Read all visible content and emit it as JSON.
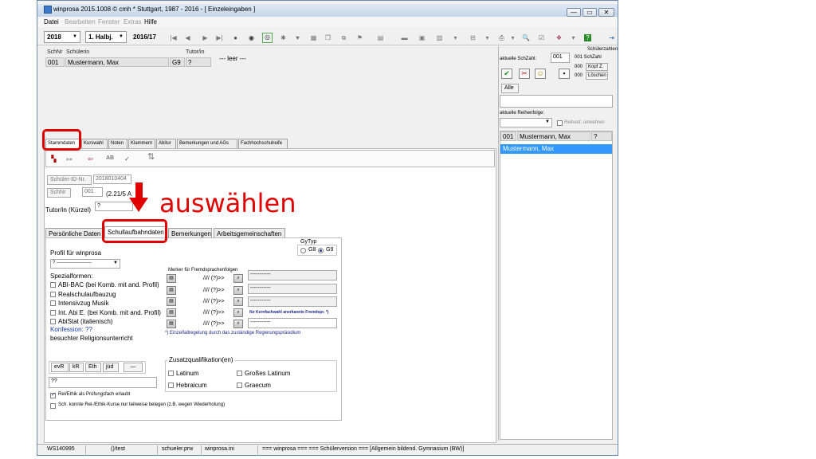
{
  "window": {
    "title": "winprosa 2015.1008 © cmh * Stuttgart, 1987 - 2016 - [ Einzeleingaben ]",
    "buttons": {
      "minimize": "—",
      "restore": "▭",
      "close": "✕"
    }
  },
  "menu": [
    "Datei",
    "Bearbeiten",
    "Fenster",
    "Extras",
    "Hilfe"
  ],
  "toolbar": {
    "year": "2018",
    "half": "1. Halbj.",
    "schoolyear": "2016/17"
  },
  "student_header": {
    "col_schnr": "SchNr",
    "col_schueler": "Schülerin",
    "col_tutor": "Tutor/in",
    "schnr": "001",
    "name": "Mustermann, Max",
    "klasse": "G9",
    "tutor": "?",
    "empty_label": "--- leer ---"
  },
  "tabs": [
    "Stammdaten",
    "Kurswahl",
    "Noten",
    "Klammern",
    "Abitur",
    "Bemerkungen und AGs",
    "Fachhochschulreife"
  ],
  "stammdaten": {
    "schueler_id_label": "Schüler-ID-Nr.",
    "schueler_id": "2018010404",
    "schnr_label": "SchNr",
    "schnr": "001",
    "schnr_extra": "(2.21/5 A",
    "tutor_label": "Tutor/in (Kürzel)",
    "tutor_value": "?"
  },
  "annotation": {
    "text": "auswählen"
  },
  "subtabs": [
    "Persönliche Daten",
    "Schullaufbahndaten",
    "Bemerkungen",
    "Arbeitsgemeinschaften"
  ],
  "schullaufbahn": {
    "gytyp_label": "GyTyp",
    "g8": "G8",
    "g9": "G9",
    "profil_label": "Profil für winprosa",
    "profil_value": "? ----------------------",
    "spezialformen_label": "Spezialformen:",
    "spezialformen": [
      "ABI-BAC (bei Komb. mit and. Profil)",
      "Realschulaufbauzug",
      "Intensivzug Musik",
      "Int. Abi E. (bei Komb. mit and. Profil)",
      "AbiStat (italienisch)"
    ],
    "konfession": "Konfession: ??",
    "religion_label": "besuchter Religionsunterricht",
    "religion_buttons": [
      "evR",
      "kR",
      "Eth",
      "jüd",
      "—"
    ],
    "religion_value": "??",
    "check_pruefung": "Rel/Ethik als Prüfungsfach erlaubt",
    "check_konnte": "Sch. konnte Rel-/Ethik-Kurse nur teilweise belegen (z.B. wegen Wiederholung)",
    "merker_label": "Merker für Fremdsprachenfolgen",
    "merker_rows": [
      {
        "code": "//// (?)>>",
        "value": "-----------"
      },
      {
        "code": "//// (?)>>",
        "value": "-----------"
      },
      {
        "code": "//// (?)>>",
        "value": "-----------"
      },
      {
        "code": "//// (?)>>",
        "value": "für Kernfachwahl anerkannte Fremdspr. *)"
      },
      {
        "code": "//// (?)>>",
        "value": "-----------"
      }
    ],
    "merker_note": "*) Einzelfallregelung durch das zuständige Regierungspräsidium",
    "zusatz_label": "Zusatzqualifikation(en)",
    "zusatz": [
      "Latinum",
      "Großes Latinum",
      "Hebraicum",
      "Graecum"
    ]
  },
  "right_panel": {
    "schuelerzahlen": "Schülerzahlen",
    "schzahl_label": "aktuelle SchZahl:",
    "schzahl": "001",
    "schzahl_small": "001 SchZahl",
    "kopf_count": "000",
    "kopf_btn": "Kopf Z.",
    "loesch_count": "000",
    "loesch_btn": "Löschen",
    "alle": "Alle",
    "reihenfolge_label": "aktuelle Reihenfolge:",
    "umkehren": "Reihenf. umkehren",
    "list_header": {
      "nr": "001",
      "name": "Mustermann, Max",
      "mark": "?"
    },
    "selected": "Mustermann, Max"
  },
  "statusbar": [
    "WS140995",
    "()/test",
    "schueler.prw",
    "winprosa.ini",
    "=== winprosa === === Schülerversion === [Allgemein bildend. Gymnasium (BW)]"
  ]
}
